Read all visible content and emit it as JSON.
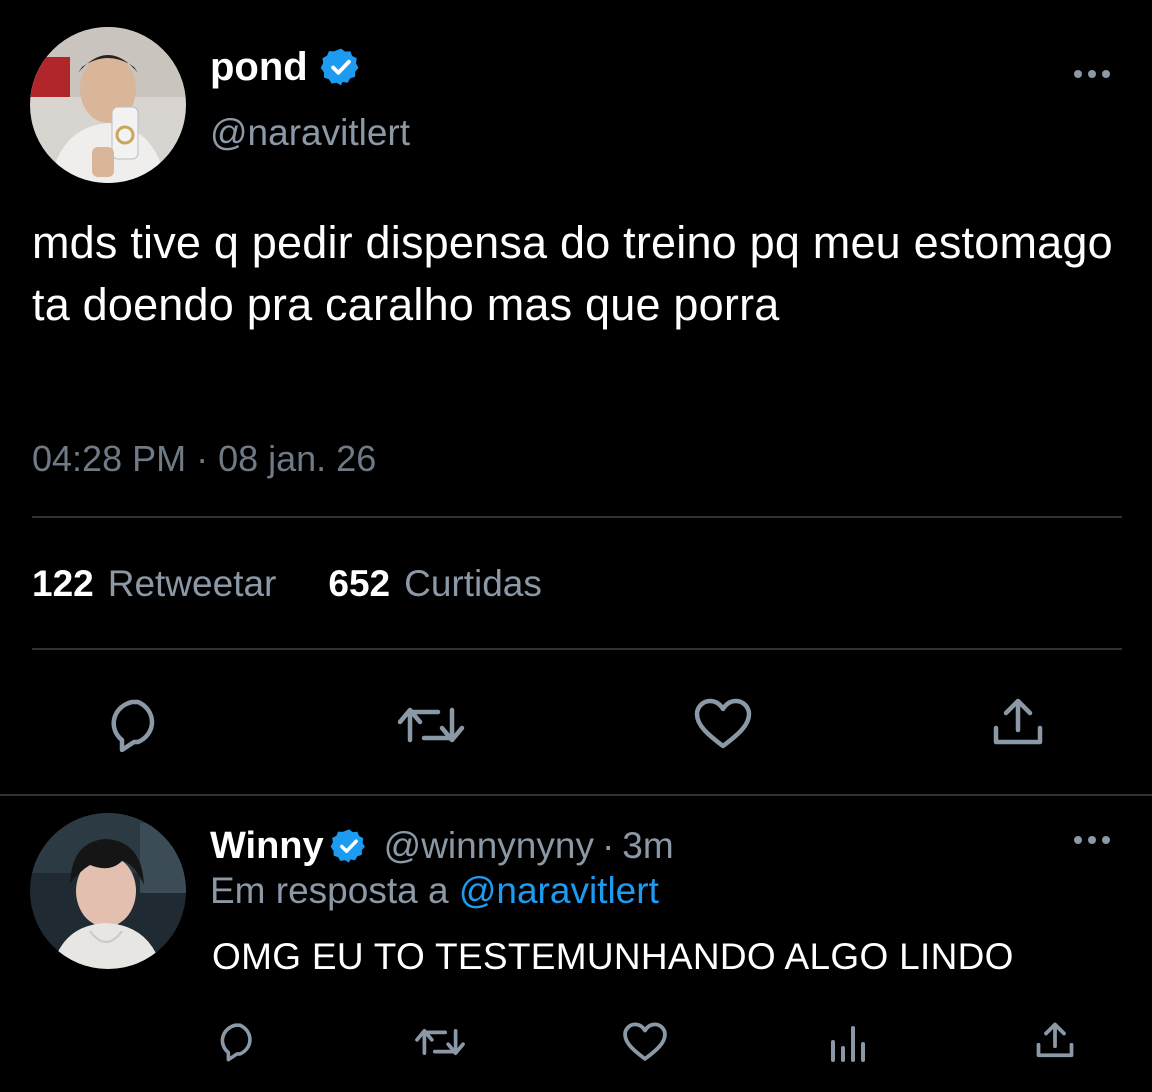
{
  "main_tweet": {
    "display_name": "pond",
    "handle": "@naravitlert",
    "verified": true,
    "text": "mds tive q pedir dispensa do treino pq meu estomago ta doendo pra caralho mas que porra",
    "timestamp": "04:28 PM · 08 jan. 26",
    "stats": {
      "retweets_count": "122",
      "retweets_label": "Retweetar",
      "likes_count": "652",
      "likes_label": "Curtidas"
    },
    "actions": [
      "reply-icon",
      "retweet-icon",
      "like-icon",
      "share-icon"
    ]
  },
  "reply_tweet": {
    "display_name": "Winny",
    "handle": "@winnynyny",
    "separator": "·",
    "time": "3m",
    "verified": true,
    "reply_prefix": "Em resposta a",
    "reply_to_handle": "@naravitlert",
    "text": "OMG EU TO TESTEMUNHANDO ALGO LINDO",
    "actions": [
      "reply-icon",
      "retweet-icon",
      "like-icon",
      "analytics-icon",
      "share-icon"
    ]
  },
  "colors": {
    "background": "#000000",
    "primary_text": "#ffffff",
    "secondary_text": "#8b98a5",
    "accent": "#1d9bf0",
    "divider": "#2f3336"
  }
}
